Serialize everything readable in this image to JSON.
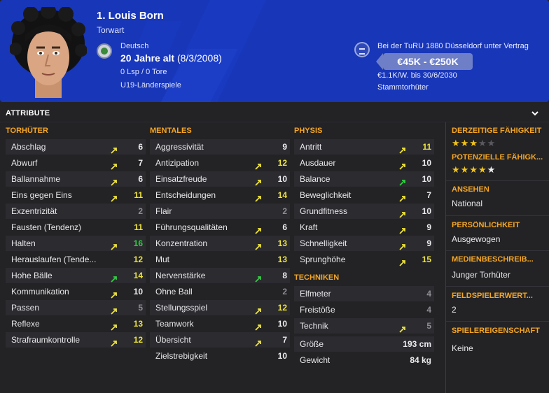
{
  "player": {
    "name": "1. Louis Born",
    "position": "Torwart",
    "nationality": "Deutsch",
    "age": "20 Jahre alt",
    "dob": "(8/3/2008)",
    "caps": "0 Lsp / 0 Tore",
    "youth_intl": "U19-Länderspiele",
    "club_contract": "Bei der TuRU 1880 Düsseldorf unter Vertrag",
    "value": "€45K - €250K",
    "wage": "€1.1K/W. bis 30/6/2030",
    "squad_role": "Stammtorhüter"
  },
  "attributes": {
    "title": "ATTRIBUTE",
    "goalkeeping": {
      "title": "TORHÜTER",
      "rows": [
        {
          "label": "Abschlag",
          "value": "6",
          "color": "white",
          "arrow": "up"
        },
        {
          "label": "Abwurf",
          "value": "7",
          "color": "white",
          "arrow": "up"
        },
        {
          "label": "Ballannahme",
          "value": "6",
          "color": "white",
          "arrow": "up"
        },
        {
          "label": "Eins gegen Eins",
          "value": "11",
          "color": "yellow",
          "arrow": "up"
        },
        {
          "label": "Exzentrizität",
          "value": "2",
          "color": "grey",
          "arrow": ""
        },
        {
          "label": "Fausten (Tendenz)",
          "value": "11",
          "color": "yellow",
          "arrow": ""
        },
        {
          "label": "Halten",
          "value": "16",
          "color": "green",
          "arrow": "up"
        },
        {
          "label": "Herauslaufen (Tende...",
          "value": "12",
          "color": "yellow",
          "arrow": ""
        },
        {
          "label": "Hohe Bälle",
          "value": "14",
          "color": "yellow",
          "arrow": "up-green"
        },
        {
          "label": "Kommunikation",
          "value": "10",
          "color": "white",
          "arrow": "up"
        },
        {
          "label": "Passen",
          "value": "5",
          "color": "grey",
          "arrow": "up"
        },
        {
          "label": "Reflexe",
          "value": "13",
          "color": "yellow",
          "arrow": "up"
        },
        {
          "label": "Strafraumkontrolle",
          "value": "12",
          "color": "yellow",
          "arrow": "up"
        }
      ]
    },
    "mental": {
      "title": "MENTALES",
      "rows": [
        {
          "label": "Aggressivität",
          "value": "9",
          "color": "white",
          "arrow": ""
        },
        {
          "label": "Antizipation",
          "value": "12",
          "color": "yellow",
          "arrow": "up"
        },
        {
          "label": "Einsatzfreude",
          "value": "10",
          "color": "white",
          "arrow": "up"
        },
        {
          "label": "Entscheidungen",
          "value": "14",
          "color": "yellow",
          "arrow": "up"
        },
        {
          "label": "Flair",
          "value": "2",
          "color": "grey",
          "arrow": ""
        },
        {
          "label": "Führungsqualitäten",
          "value": "6",
          "color": "white",
          "arrow": "up"
        },
        {
          "label": "Konzentration",
          "value": "13",
          "color": "yellow",
          "arrow": "up"
        },
        {
          "label": "Mut",
          "value": "13",
          "color": "yellow",
          "arrow": ""
        },
        {
          "label": "Nervenstärke",
          "value": "8",
          "color": "white",
          "arrow": "up-green"
        },
        {
          "label": "Ohne Ball",
          "value": "2",
          "color": "grey",
          "arrow": ""
        },
        {
          "label": "Stellungsspiel",
          "value": "12",
          "color": "yellow",
          "arrow": "up"
        },
        {
          "label": "Teamwork",
          "value": "10",
          "color": "white",
          "arrow": "up"
        },
        {
          "label": "Übersicht",
          "value": "7",
          "color": "white",
          "arrow": "up"
        },
        {
          "label": "Zielstrebigkeit",
          "value": "10",
          "color": "white",
          "arrow": ""
        }
      ]
    },
    "physical": {
      "title": "PHYSIS",
      "rows": [
        {
          "label": "Antritt",
          "value": "11",
          "color": "yellow",
          "arrow": "up"
        },
        {
          "label": "Ausdauer",
          "value": "10",
          "color": "white",
          "arrow": "up"
        },
        {
          "label": "Balance",
          "value": "10",
          "color": "white",
          "arrow": "up-green"
        },
        {
          "label": "Beweglichkeit",
          "value": "7",
          "color": "white",
          "arrow": "up"
        },
        {
          "label": "Grundfitness",
          "value": "10",
          "color": "white",
          "arrow": "up"
        },
        {
          "label": "Kraft",
          "value": "9",
          "color": "white",
          "arrow": "up"
        },
        {
          "label": "Schnelligkeit",
          "value": "9",
          "color": "white",
          "arrow": "up"
        },
        {
          "label": "Sprunghöhe",
          "value": "15",
          "color": "yellow",
          "arrow": "up"
        }
      ]
    },
    "technical": {
      "title": "TECHNIKEN",
      "rows": [
        {
          "label": "Elfmeter",
          "value": "4",
          "color": "grey",
          "arrow": ""
        },
        {
          "label": "Freistöße",
          "value": "4",
          "color": "grey",
          "arrow": ""
        },
        {
          "label": "Technik",
          "value": "5",
          "color": "grey",
          "arrow": "up"
        }
      ]
    },
    "body": [
      {
        "label": "Größe",
        "value": "193 cm"
      },
      {
        "label": "Gewicht",
        "value": "84 kg"
      }
    ]
  },
  "side": {
    "current_ability": {
      "title": "DERZEITIGE FÄHIGKEIT",
      "stars": 3,
      "max": 5
    },
    "potential_ability": {
      "title": "POTENZIELLE FÄHIGK...",
      "stars": 4,
      "max": 5
    },
    "reputation": {
      "title": "ANSEHEN",
      "value": "National"
    },
    "personality": {
      "title": "PERSÖNLICHKEIT",
      "value": "Ausgewogen"
    },
    "media": {
      "title": "MEDIENBESCHREIB...",
      "value": "Junger Torhüter"
    },
    "outfield": {
      "title": "FELDSPIELERWERT...",
      "value": "2"
    },
    "traits": {
      "title": "SPIELEREIGENSCHAFT",
      "value": "Keine"
    }
  },
  "colors": {
    "header_bg": "#1836b8",
    "accent": "#f5a623",
    "yellow": "#ede33f",
    "green": "#33cc44"
  }
}
